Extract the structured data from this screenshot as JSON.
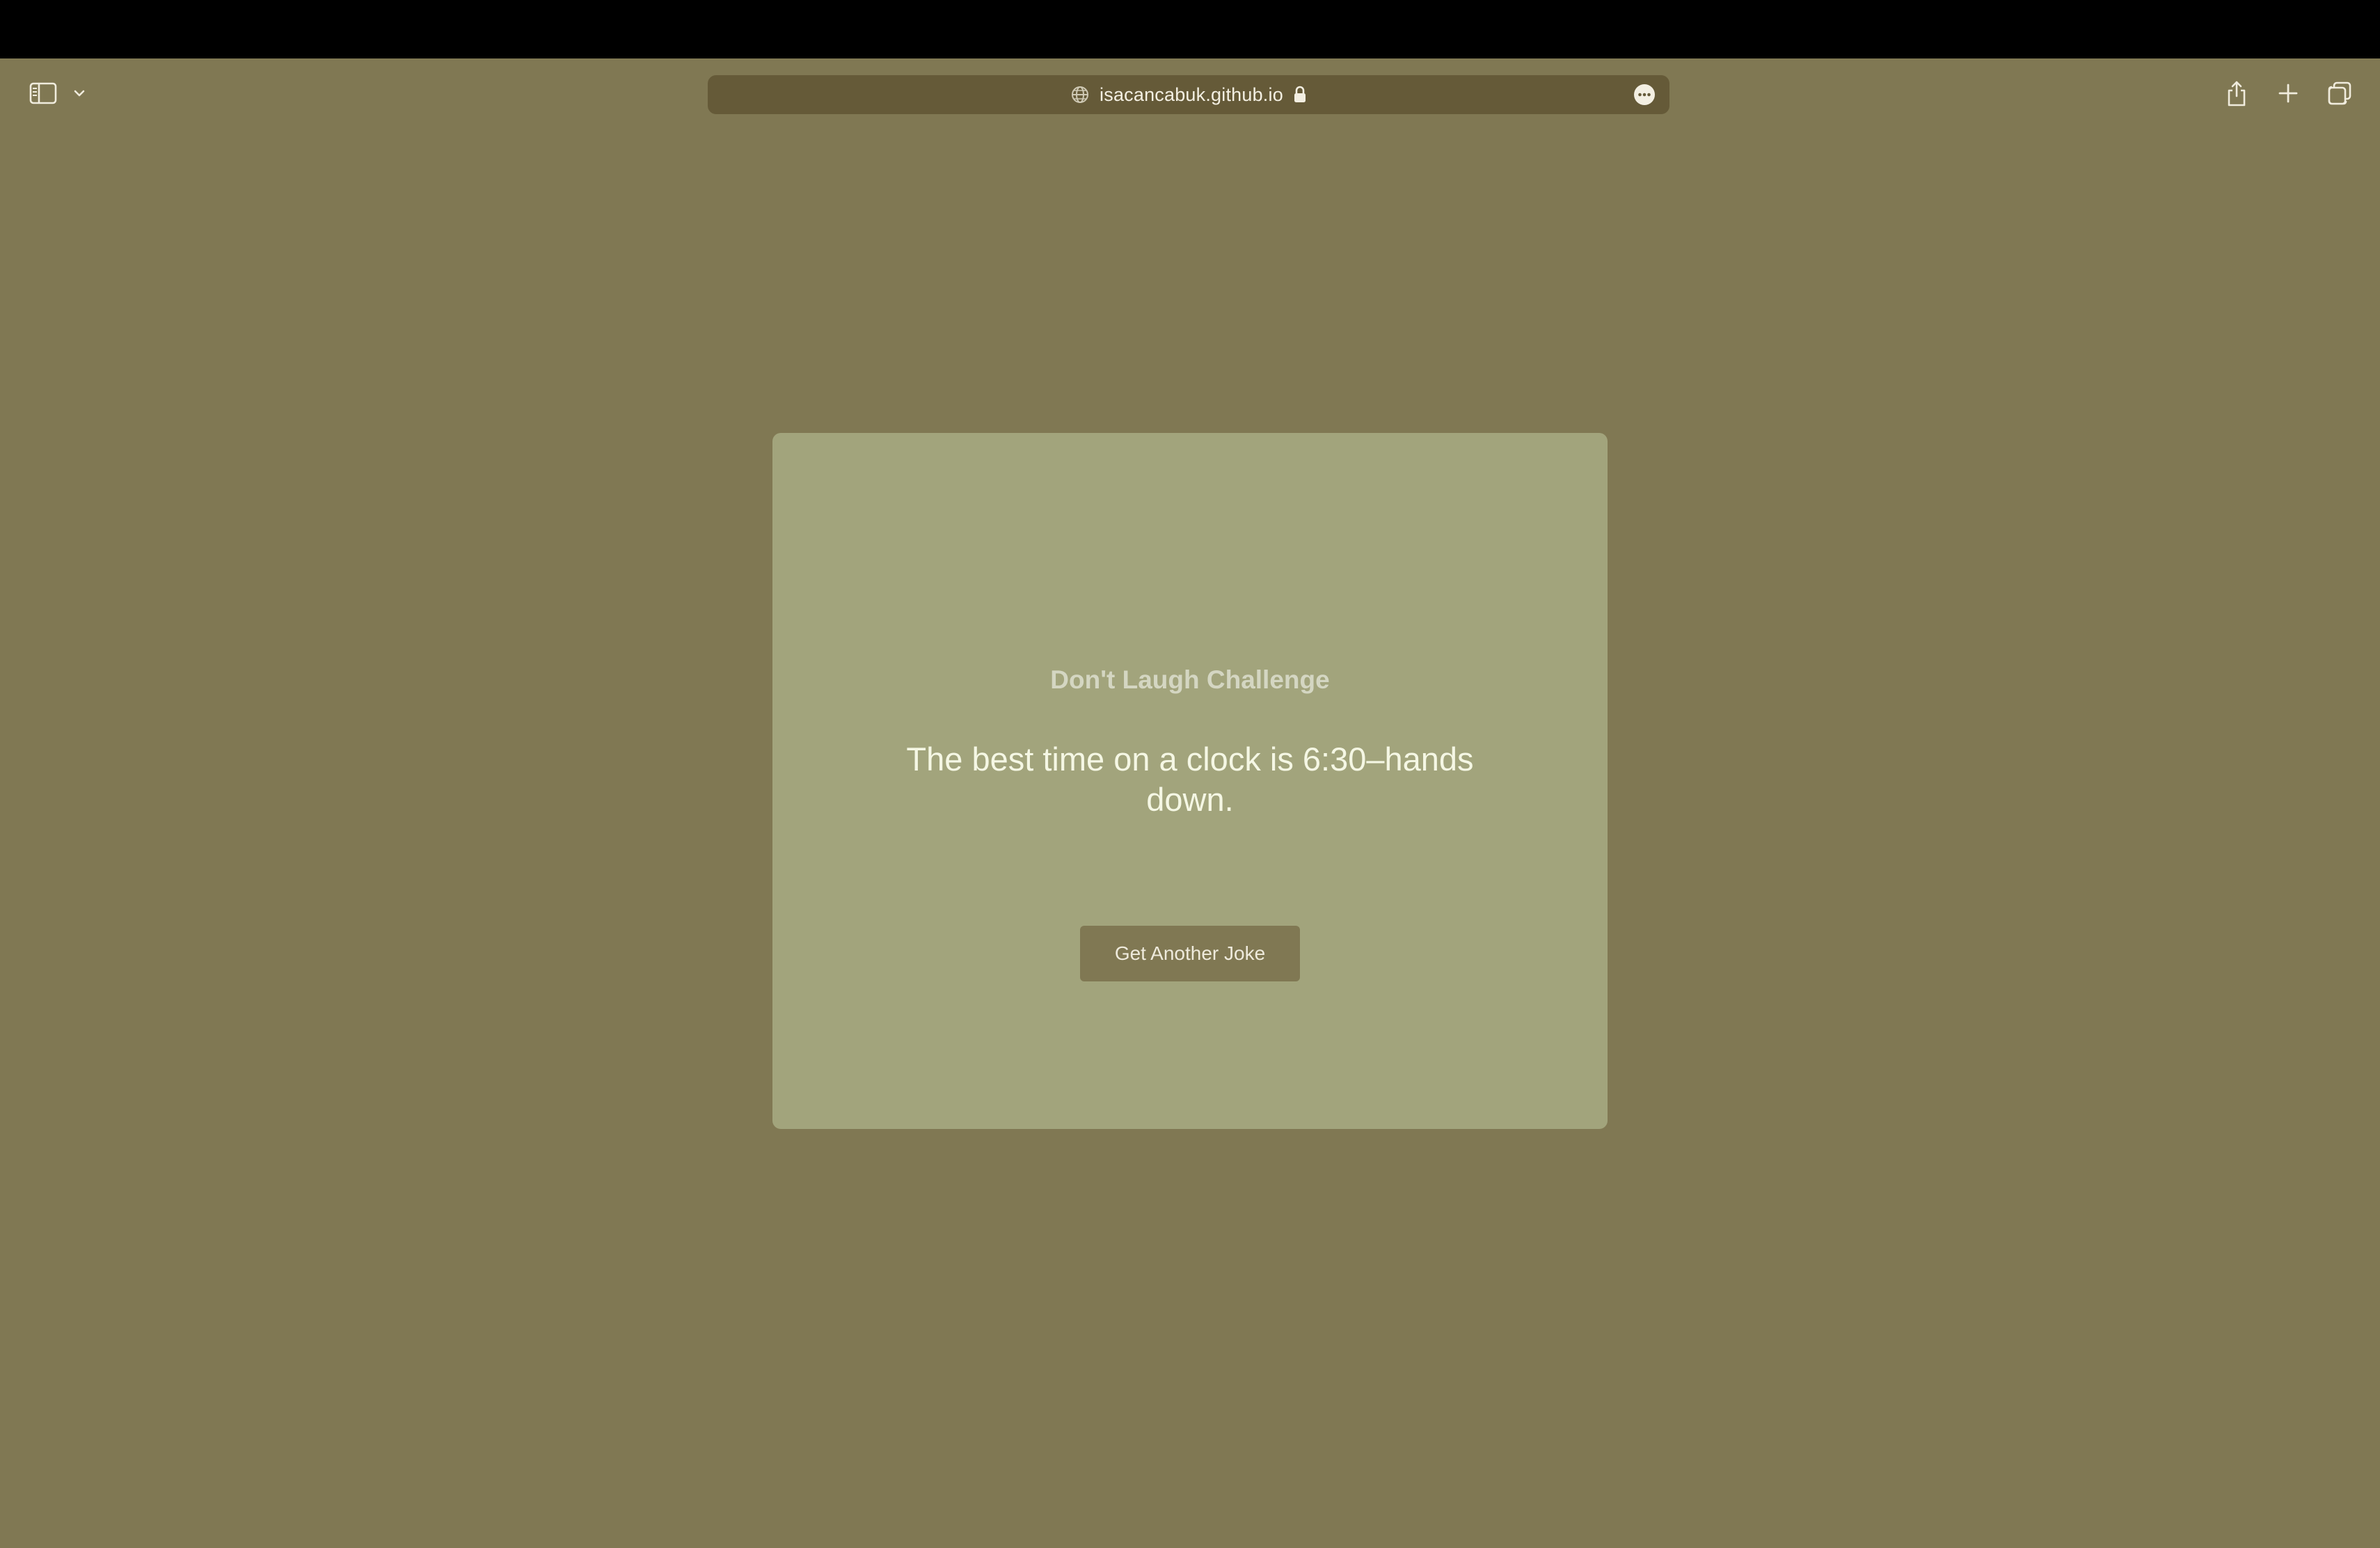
{
  "browser": {
    "address_bar": {
      "url": "isacancabuk.github.io"
    },
    "icons": {
      "sidebar": "sidebar-icon",
      "chevron": "chevron-down-icon",
      "globe": "globe-icon",
      "lock": "lock-icon",
      "more": "ellipsis-circle-icon",
      "share": "share-icon",
      "new_tab": "plus-icon",
      "tabs": "tab-overview-icon"
    }
  },
  "page": {
    "title": "Don't Laugh Challenge",
    "joke": "The best time on a clock is 6:30–hands down.",
    "button_label": "Get Another Joke"
  },
  "colors": {
    "background": "#807853",
    "card": "#a2a47c",
    "address_bar": "#655a38",
    "button": "#807853",
    "joke_text": "#f5f7e4",
    "title_text": "#d4d6c2"
  }
}
